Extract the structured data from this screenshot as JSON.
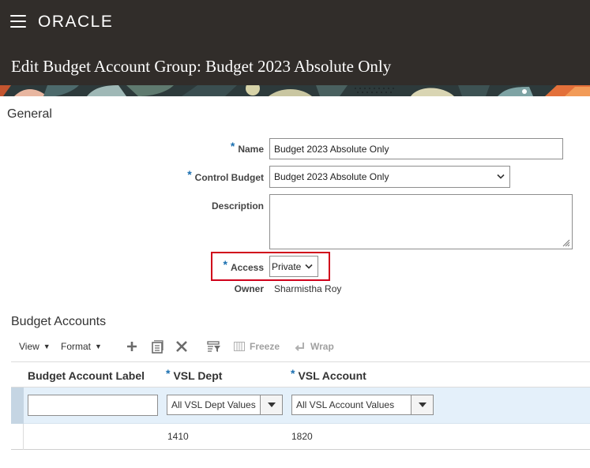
{
  "header": {
    "logo": "ORACLE",
    "title": "Edit Budget Account Group: Budget 2023 Absolute Only"
  },
  "general": {
    "section_title": "General",
    "name_label": "Name",
    "name_value": "Budget 2023 Absolute Only",
    "control_budget_label": "Control Budget",
    "control_budget_value": "Budget 2023 Absolute Only",
    "description_label": "Description",
    "description_value": "",
    "access_label": "Access",
    "access_value": "Private",
    "owner_label": "Owner",
    "owner_value": "Sharmistha Roy",
    "required_mark": "*"
  },
  "budget_accounts": {
    "section_title": "Budget Accounts",
    "toolbar": {
      "view": "View",
      "format": "Format",
      "freeze": "Freeze",
      "wrap": "Wrap"
    },
    "columns": [
      "Budget Account Label",
      "VSL Dept",
      "VSL Account"
    ],
    "rows": [
      {
        "label": "",
        "dept": "All VSL Dept Values",
        "account": "All VSL Account Values"
      },
      {
        "label": "",
        "dept": "1410",
        "account": "1820"
      }
    ]
  },
  "colors": {
    "header_bg": "#312d2a",
    "required": "#1a6fb0",
    "highlight": "#d0021b",
    "selected_row": "#e4f0fa"
  }
}
